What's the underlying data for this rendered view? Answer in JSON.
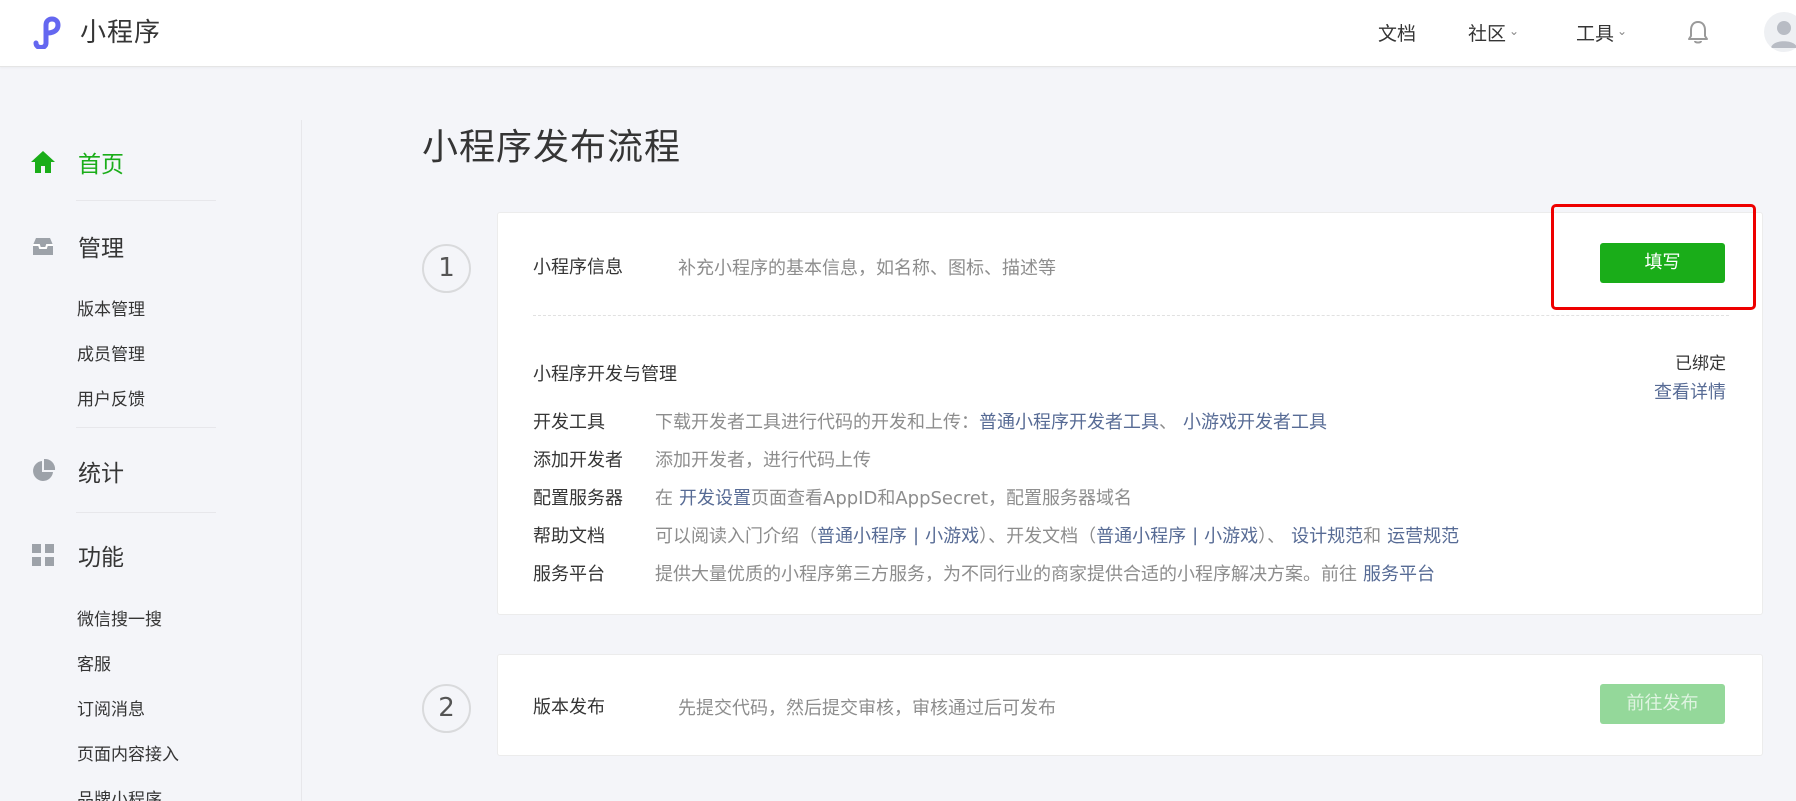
{
  "header": {
    "logo_text": "小程序",
    "nav": [
      {
        "label": "文档"
      },
      {
        "label": "社区",
        "has_dropdown": true
      },
      {
        "label": "工具",
        "has_dropdown": true
      }
    ],
    "icons": [
      "miniprogram-logo-icon",
      "bell-icon",
      "avatar"
    ]
  },
  "sidebar": {
    "home": "首页",
    "manage": "管理",
    "manage_items": [
      "版本管理",
      "成员管理",
      "用户反馈"
    ],
    "stats": "统计",
    "features": "功能",
    "feature_items": [
      "微信搜一搜",
      "客服",
      "订阅消息",
      "页面内容接入",
      "品牌小程序"
    ]
  },
  "main": {
    "title": "小程序发布流程",
    "step1": {
      "number": "1",
      "label": "小程序信息",
      "desc": "补充小程序的基本信息，如名称、图标、描述等",
      "button": "填写"
    },
    "dev": {
      "title": "小程序开发与管理",
      "status": "已绑定",
      "detail_link": "查看详情",
      "rows": {
        "tools": {
          "label": "开发工具",
          "text": "下载开发者工具进行代码的开发和上传：",
          "link1": "普通小程序开发者工具",
          "between": "、",
          "link2": "小游戏开发者工具"
        },
        "add_dev": {
          "label": "添加开发者",
          "text": "添加开发者，进行代码上传"
        },
        "server": {
          "label": "配置服务器",
          "pre": "在",
          "link": "开发设置",
          "post": "页面查看AppID和AppSecret，配置服务器域名"
        },
        "help": {
          "label": "帮助文档",
          "pre": "可以阅读入门介绍（",
          "link1": "普通小程序",
          "sep": "|",
          "link2": "小游戏",
          "mid": "）、开发文档（",
          "link3": "普通小程序",
          "link4": "小游戏",
          "mid2": "）、",
          "link5": "设计规范",
          "and": "和",
          "link6": "运营规范"
        },
        "service": {
          "label": "服务平台",
          "text": "提供大量优质的小程序第三方服务，为不同行业的商家提供合适的小程序解决方案。前往",
          "link": "服务平台"
        }
      }
    },
    "step2": {
      "number": "2",
      "label": "版本发布",
      "desc": "先提交代码，然后提交审核，审核通过后可发布",
      "button": "前往发布"
    }
  },
  "colors": {
    "brand_green": "#1aad19",
    "link_blue": "#576b95",
    "highlight_red": "#ee0000",
    "disabled_green": "#94d89a"
  }
}
